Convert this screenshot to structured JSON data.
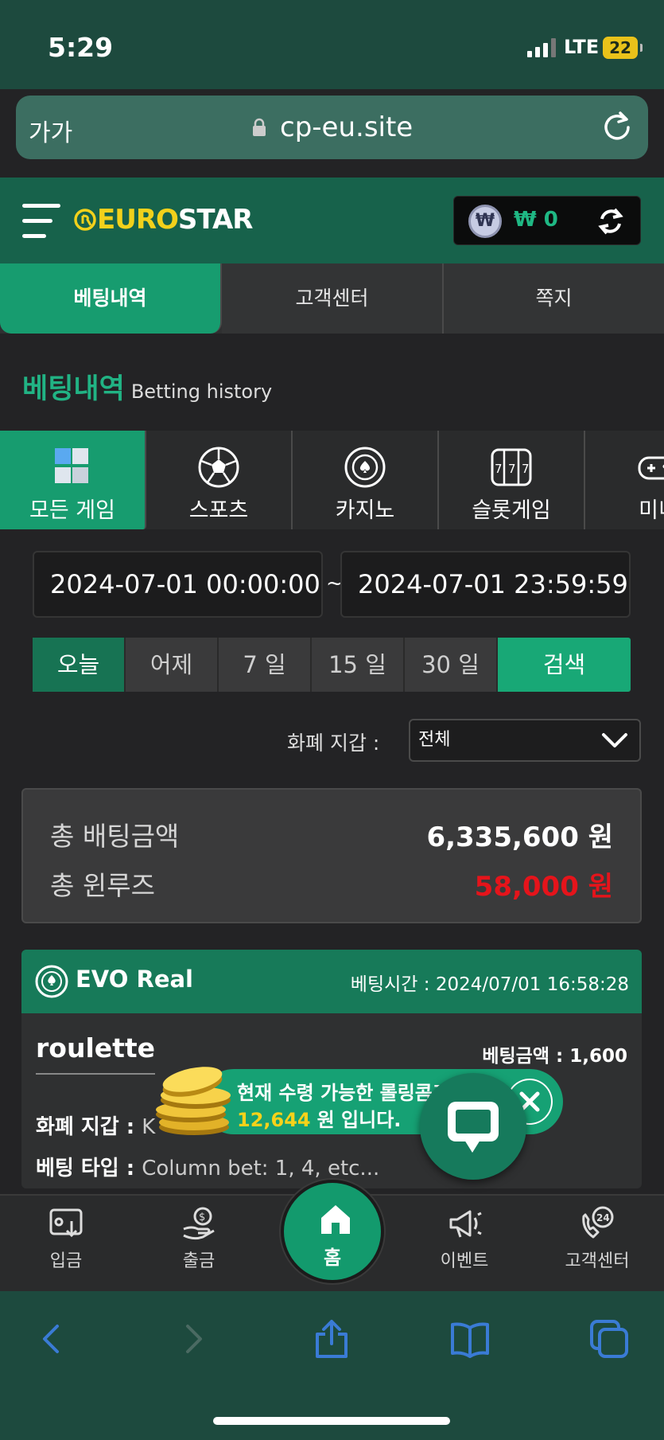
{
  "status": {
    "time": "5:29",
    "network": "LTE",
    "battery": "22"
  },
  "browser": {
    "text_size": "가가",
    "url": "cp-eu.site"
  },
  "header": {
    "logo_prefix": "EURO",
    "logo_suffix": "STAR",
    "wallet_symbol": "₩",
    "balance": "₩ 0"
  },
  "tabs": [
    {
      "label": "베팅내역",
      "active": true
    },
    {
      "label": "고객센터",
      "active": false
    },
    {
      "label": "쪽지",
      "active": false
    }
  ],
  "page": {
    "title": "베팅내역",
    "subtitle": "Betting history"
  },
  "categories": [
    {
      "label": "모든 게임",
      "icon": "cubes-icon",
      "active": true
    },
    {
      "label": "스포츠",
      "icon": "soccer-ball-icon",
      "active": false
    },
    {
      "label": "카지노",
      "icon": "casino-chip-icon",
      "active": false
    },
    {
      "label": "슬롯게임",
      "icon": "slot-machine-icon",
      "active": false
    },
    {
      "label": "미니",
      "icon": "gamepad-icon",
      "active": false
    }
  ],
  "filter": {
    "date_from": "2024-07-01 00:00:00",
    "date_to": "2024-07-01 23:59:59",
    "separator": "~",
    "quick_ranges": [
      "오늘",
      "어제",
      "7 일",
      "15 일",
      "30 일"
    ],
    "active_range": "오늘",
    "search_label": "검색",
    "wallet_label": "화폐 지갑 :",
    "wallet_value": "전체"
  },
  "summary": {
    "total_bet_label": "총 배팅금액",
    "total_bet_value": "6,335,600 원",
    "total_winloss_label": "총 윈루즈",
    "total_winloss_value": "58,000 원"
  },
  "bet_card": {
    "provider": "EVO Real",
    "bet_time_label": "베팅시간 :",
    "bet_time": "2024/07/01 16:58:28",
    "game": "roulette",
    "bet_amount_label": "베팅금액 :",
    "bet_amount": "1,600",
    "wallet_label": "화폐 지갑 :",
    "wallet_value": "K",
    "bet_type_label": "베팅 타입 :",
    "bet_type_value": "Column bet: 1, 4, etc..."
  },
  "promo": {
    "line1": "현재 수령 가능한 롤링콤프",
    "amount": "12,644",
    "line2_suffix": "원 입니다."
  },
  "bottom_nav": [
    {
      "label": "입금",
      "icon": "deposit-icon"
    },
    {
      "label": "출금",
      "icon": "withdraw-icon"
    },
    {
      "label": "홈",
      "icon": "home-icon"
    },
    {
      "label": "이벤트",
      "icon": "megaphone-icon"
    },
    {
      "label": "고객센터",
      "icon": "support-24-icon"
    }
  ],
  "colors": {
    "accent": "#179c6f",
    "header_green": "#17624b",
    "loss_red": "#e5141b",
    "logo_yellow": "#f2d11b",
    "safari_blue": "#3a7bd5"
  }
}
